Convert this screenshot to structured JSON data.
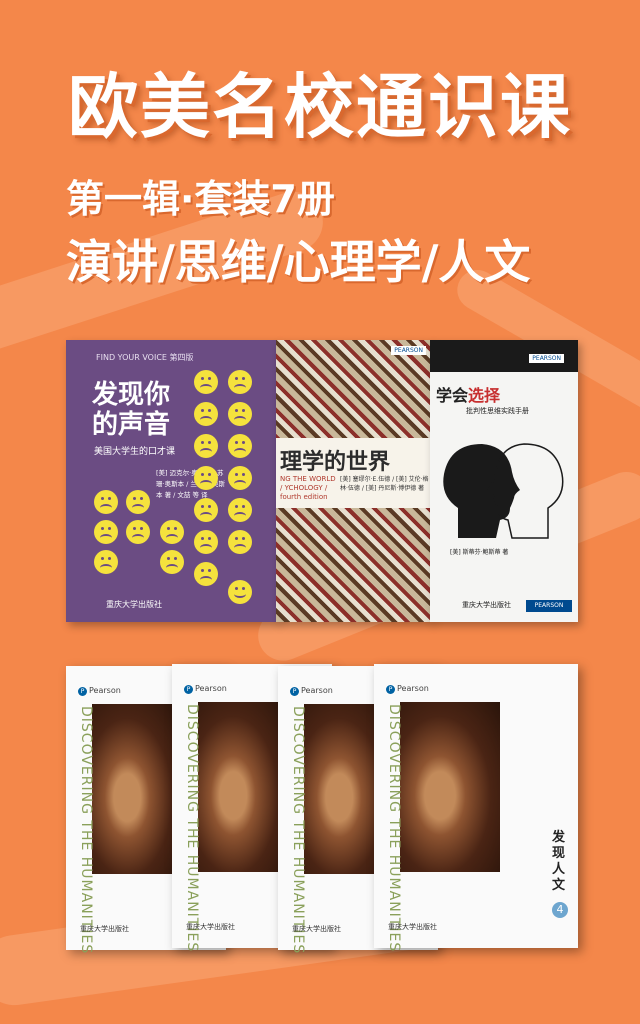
{
  "heading": {
    "main": "欧美名校通识课",
    "sub": "第一辑·套装7册",
    "topics": "演讲/思维/心理学/人文"
  },
  "books": {
    "voice": {
      "top_label": "FIND YOUR VOICE  第四版",
      "title": "发现你的声音",
      "subtitle": "美国大学生的口才课",
      "authors": "[美] 迈克尔·奥斯本 / 苏珊·奥斯本 / 兰德尔·奥斯本 著 / 文喆 等 译",
      "publisher": "重庆大学出版社"
    },
    "psych": {
      "title": "理学的世界",
      "eng": "NG THE WORLD / YCHOLOGY / fourth edition",
      "authors": "[美] 塞缪尔·E.伍德 / [美] 艾伦·格林·伍德 / [美] 丹尼斯·博伊德 著",
      "pearson": "PEARSON"
    },
    "choice": {
      "title_prefix": "学会",
      "title_accent": "选择",
      "subtitle": "批判性思维实践手册",
      "author": "[美] 斯蒂芬·鲍斯蒂 著",
      "publisher": "重庆大学出版社",
      "pearson": "PEARSON"
    },
    "humanities": {
      "pearson": "Pearson",
      "title": "DISCOVERING THE HUMANITIES",
      "publisher": "重庆大学出版社",
      "label": "发现人文",
      "number": "4"
    }
  }
}
